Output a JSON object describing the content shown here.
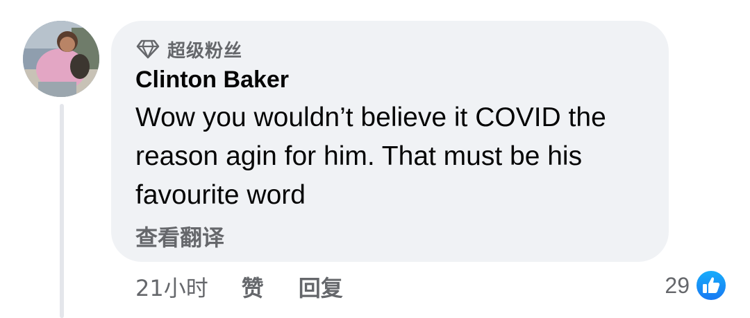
{
  "comment": {
    "badge": {
      "icon": "diamond-icon",
      "label": "超级粉丝"
    },
    "author": "Clinton Baker",
    "text": "Wow you wouldn’t believe it COVID the reason agin for him. That must be his favourite word",
    "translate_label": "查看翻译",
    "timestamp": "21小时",
    "like_label": "赞",
    "reply_label": "回复",
    "reaction_count": "29",
    "reaction_icon": "like-thumbs-up-icon"
  },
  "colors": {
    "bubble_background": "#f0f2f5",
    "secondary_text": "#65676b",
    "primary_text": "#050505",
    "like_blue": "#1877f2"
  }
}
